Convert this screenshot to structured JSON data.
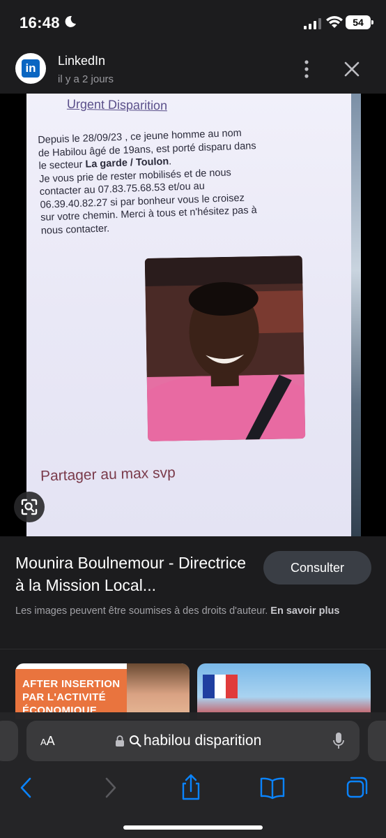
{
  "status": {
    "time": "16:48",
    "battery": "54"
  },
  "header": {
    "logo_text": "in",
    "source_name": "LinkedIn",
    "source_date": "il y a 2 jours"
  },
  "poster": {
    "title": "Urgent Disparition",
    "line1": "Depuis le 28/09/23 , ce jeune homme au nom",
    "line2": "de Habilou âgé de 19ans, est porté disparu dans",
    "line3_prefix": "le secteur ",
    "line3_bold": "La garde / Toulon",
    "line3_suffix": ".",
    "line4": "Je vous prie de rester mobilisés et de nous",
    "line5": "contacter au 07.83.75.68.53 et/ou au",
    "line6": "06.39.40.82.27 si par bonheur vous le croisez",
    "line7": "sur votre chemin. Merci à tous et n'hésitez pas à",
    "line8": "nous contacter.",
    "footer": "Partager au max svp"
  },
  "info": {
    "title": "Mounira Boulnemour - Directrice à la Mission Local...",
    "consult_label": "Consulter",
    "copyright_text": "Les images peuvent être soumises à des droits d'auteur. ",
    "learn_more": "En savoir plus"
  },
  "thumbs": [
    {
      "line1": "AFTER INSERTION",
      "line2": "PAR L'ACTIVITÉ",
      "line3": "ÉCONOMIQUE"
    },
    {}
  ],
  "browser": {
    "aa_label": "AA",
    "url_text": "habilou disparition"
  },
  "colors": {
    "background": "#1c1c1e",
    "accent": "#0a84ff",
    "linkedin": "#0a66c2",
    "button": "#3a3e45"
  },
  "icons": [
    "moon-icon",
    "signal-icon",
    "wifi-icon",
    "more-icon",
    "close-icon",
    "lens-icon",
    "lock-icon",
    "search-icon",
    "mic-icon",
    "back-icon",
    "forward-icon",
    "share-icon",
    "bookmarks-icon",
    "tabs-icon"
  ]
}
